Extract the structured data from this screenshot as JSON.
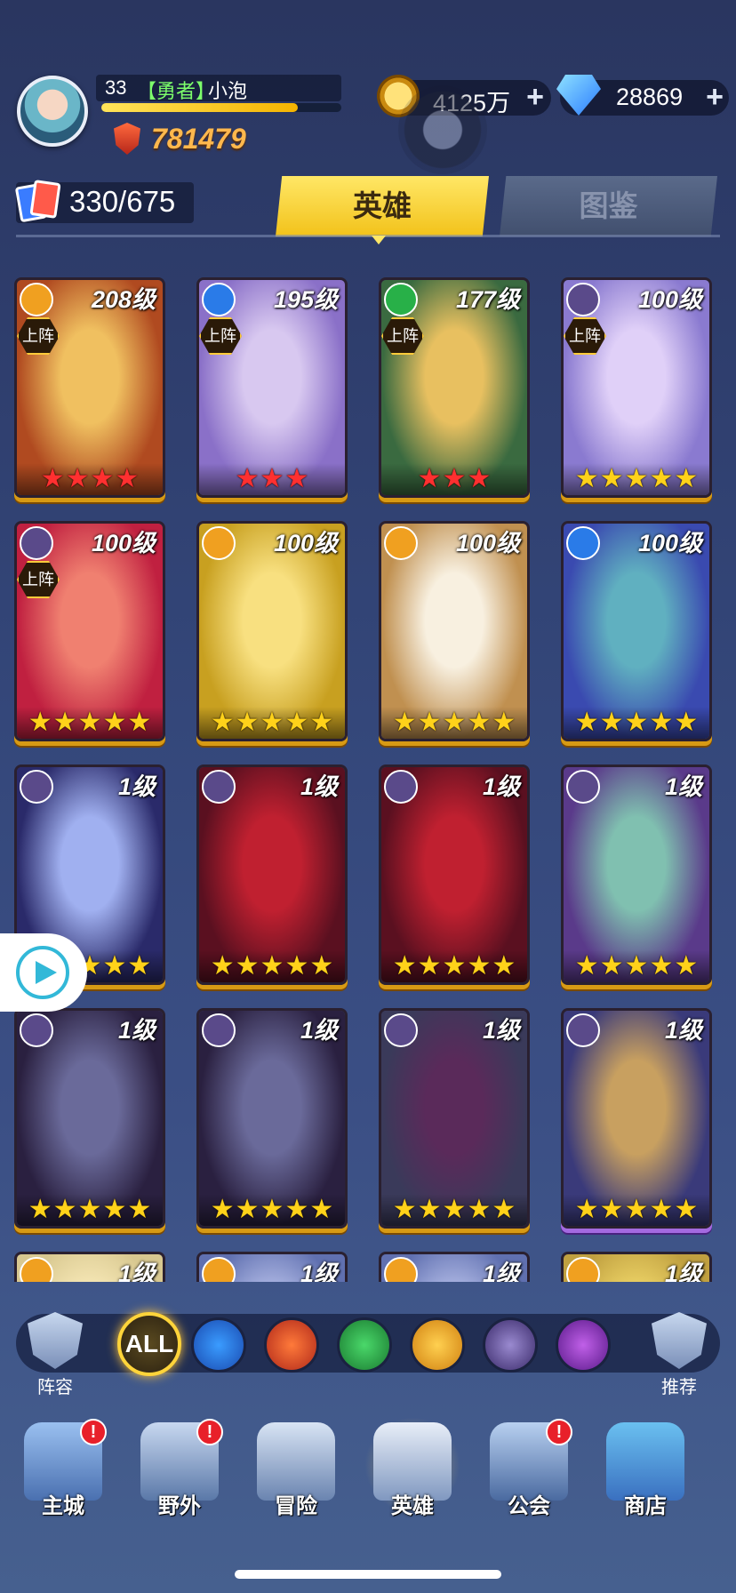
{
  "player": {
    "level": "33",
    "title": "【勇者】",
    "name": "小泡",
    "xp_fraction": 0.82,
    "power": "781479"
  },
  "resources": {
    "gold": "4125万",
    "gems": "28869"
  },
  "collection": {
    "count": "330/675"
  },
  "tabs": [
    {
      "label": "英雄",
      "active": true
    },
    {
      "label": "图鉴",
      "active": false
    }
  ],
  "heroes": [
    {
      "level": "208级",
      "element": "light",
      "deployed": "上阵",
      "stars": 4,
      "star_color": "red"
    },
    {
      "level": "195级",
      "element": "water",
      "deployed": "上阵",
      "stars": 3,
      "star_color": "red"
    },
    {
      "level": "177级",
      "element": "nature",
      "deployed": "上阵",
      "stars": 3,
      "star_color": "red"
    },
    {
      "level": "100级",
      "element": "dark",
      "deployed": "上阵",
      "stars": 5,
      "star_color": "gold"
    },
    {
      "level": "100级",
      "element": "dark",
      "deployed": "上阵",
      "stars": 5,
      "star_color": "gold"
    },
    {
      "level": "100级",
      "element": "light",
      "deployed": "",
      "stars": 5,
      "star_color": "gold"
    },
    {
      "level": "100级",
      "element": "light",
      "deployed": "",
      "stars": 5,
      "star_color": "gold"
    },
    {
      "level": "100级",
      "element": "water",
      "deployed": "",
      "stars": 5,
      "star_color": "gold"
    },
    {
      "level": "1级",
      "element": "dark",
      "deployed": "",
      "stars": 5,
      "star_color": "gold"
    },
    {
      "level": "1级",
      "element": "dark",
      "deployed": "",
      "stars": 5,
      "star_color": "gold"
    },
    {
      "level": "1级",
      "element": "dark",
      "deployed": "",
      "stars": 5,
      "star_color": "gold"
    },
    {
      "level": "1级",
      "element": "dark",
      "deployed": "",
      "stars": 5,
      "star_color": "gold"
    },
    {
      "level": "1级",
      "element": "dark",
      "deployed": "",
      "stars": 5,
      "star_color": "gold"
    },
    {
      "level": "1级",
      "element": "dark",
      "deployed": "",
      "stars": 5,
      "star_color": "gold"
    },
    {
      "level": "1级",
      "element": "dark",
      "deployed": "",
      "stars": 5,
      "star_color": "gold"
    },
    {
      "level": "1级",
      "element": "dark",
      "deployed": "",
      "stars": 5,
      "star_color": "gold"
    },
    {
      "level": "1级",
      "element": "light",
      "deployed": "",
      "stars": 0,
      "star_color": "gold"
    },
    {
      "level": "1级",
      "element": "light",
      "deployed": "",
      "stars": 0,
      "star_color": "gold"
    },
    {
      "level": "1级",
      "element": "light",
      "deployed": "",
      "stars": 0,
      "star_color": "gold"
    },
    {
      "level": "1级",
      "element": "light",
      "deployed": "",
      "stars": 0,
      "star_color": "gold"
    }
  ],
  "element_colors": {
    "light": "#f0a020",
    "water": "#2a7be8",
    "nature": "#28b048",
    "dark": "#5a4a8a",
    "fire": "#e8501a",
    "chaos": "#9a30c0"
  },
  "factions": {
    "lineup": "阵容",
    "all": "ALL",
    "recommend": "推荐",
    "filters": [
      "water",
      "fire",
      "nature",
      "light",
      "dark",
      "chaos"
    ]
  },
  "nav": [
    {
      "label": "主城",
      "alert": "!"
    },
    {
      "label": "野外",
      "alert": "!"
    },
    {
      "label": "冒险",
      "alert": ""
    },
    {
      "label": "英雄",
      "alert": ""
    },
    {
      "label": "公会",
      "alert": "!"
    },
    {
      "label": "商店",
      "alert": ""
    }
  ],
  "colors": {
    "accent": "#f2c21a",
    "gold_border": "#d79a14",
    "star_red": "#ff3030",
    "star_gold": "#ffd21a"
  }
}
